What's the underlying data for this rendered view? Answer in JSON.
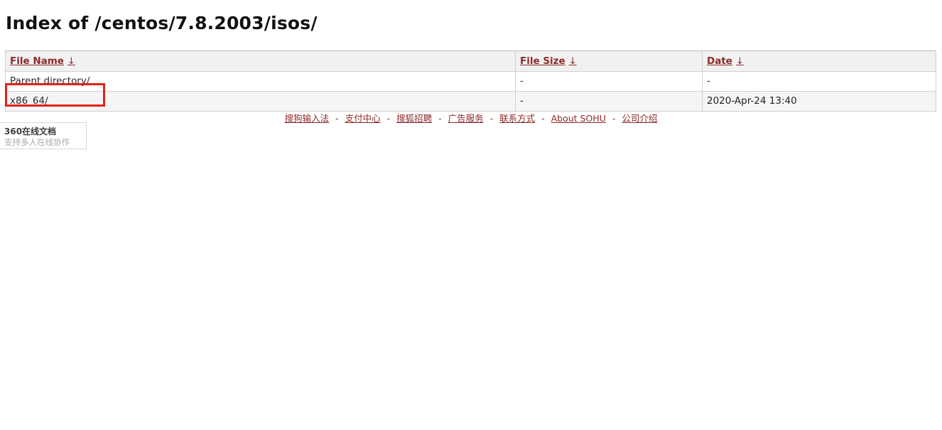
{
  "page": {
    "title": "Index of /centos/7.8.2003/isos/"
  },
  "table": {
    "columns": [
      {
        "label": "File Name",
        "sort_icon": "arrow-down-icon",
        "sort_glyph": "↓"
      },
      {
        "label": "File Size",
        "sort_icon": "arrow-down-icon",
        "sort_glyph": "↓"
      },
      {
        "label": "Date",
        "sort_icon": "arrow-down-icon",
        "sort_glyph": "↓"
      }
    ],
    "rows": [
      {
        "name": "Parent directory/",
        "size": "-",
        "date": "-"
      },
      {
        "name": "x86_64/",
        "size": "-",
        "date": "2020-Apr-24 13:40"
      }
    ]
  },
  "highlight": {
    "target": "x86_64/",
    "color": "#e32119"
  },
  "footer": {
    "separator": "-",
    "links": [
      "搜狗输入法",
      "支付中心",
      "搜狐招聘",
      "广告服务",
      "联系方式",
      "About SOHU",
      "公司介绍"
    ]
  },
  "doc_popup": {
    "title": "360在线文档",
    "subtitle": "支持多人在线协作"
  },
  "colors": {
    "link_header": "#8c2a2a",
    "link_file": "#2b2b2b",
    "highlight": "#e32119",
    "header_bg": "#f1f1f1",
    "row_stripe": "#f5f5f5"
  }
}
